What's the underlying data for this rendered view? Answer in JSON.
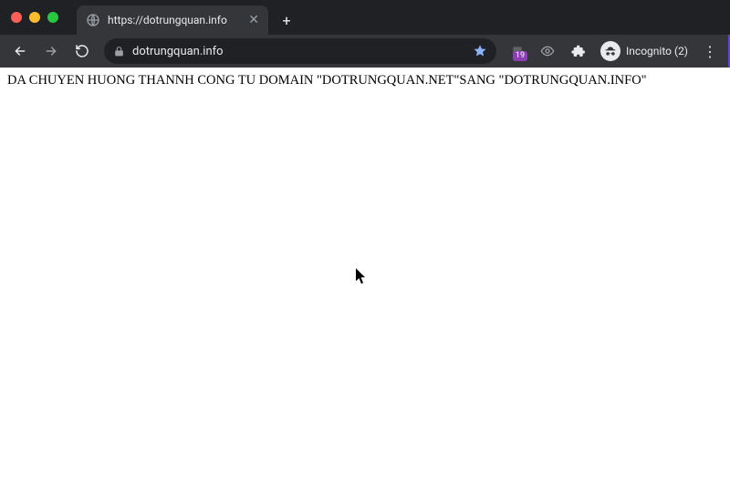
{
  "tab": {
    "title": "https://dotrungquan.info"
  },
  "toolbar": {
    "url": "dotrungquan.info",
    "extension_badge": "19",
    "incognito_label": "Incognito (2)"
  },
  "page": {
    "body_text": "DA CHUYEN HUONG THANNH CONG TU DOMAIN \"DOTRUNGQUAN.NET\"SANG \"DOTRUNGQUAN.INFO\""
  }
}
